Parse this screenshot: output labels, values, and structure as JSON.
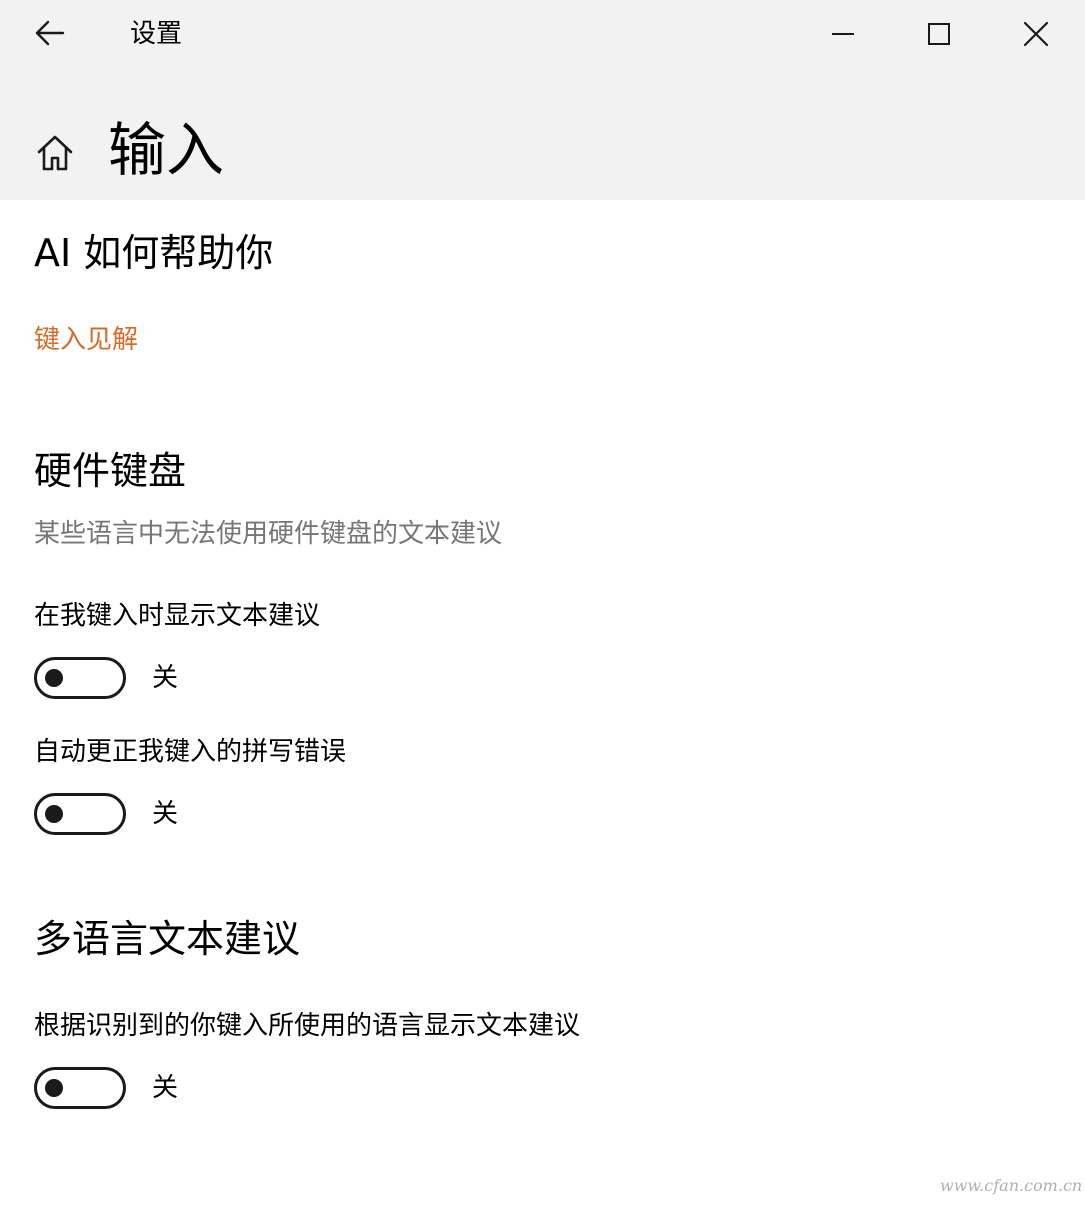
{
  "window": {
    "app_title": "设置",
    "page_title": "输入"
  },
  "sections": {
    "ai": {
      "heading": "AI 如何帮助你",
      "link": "键入见解"
    },
    "hardware_keyboard": {
      "heading": "硬件键盘",
      "description": "某些语言中无法使用硬件键盘的文本建议",
      "settings": [
        {
          "label": "在我键入时显示文本建议",
          "state": "关",
          "on": false
        },
        {
          "label": "自动更正我键入的拼写错误",
          "state": "关",
          "on": false
        }
      ]
    },
    "multilingual": {
      "heading": "多语言文本建议",
      "settings": [
        {
          "label": "根据识别到的你键入所使用的语言显示文本建议",
          "state": "关",
          "on": false
        }
      ]
    }
  },
  "watermark": "www.cfan.com.cn",
  "colors": {
    "header_bg": "#f2f2f2",
    "link": "#d86b29",
    "description": "#767676",
    "toggle_off": "#1a1a1a"
  }
}
